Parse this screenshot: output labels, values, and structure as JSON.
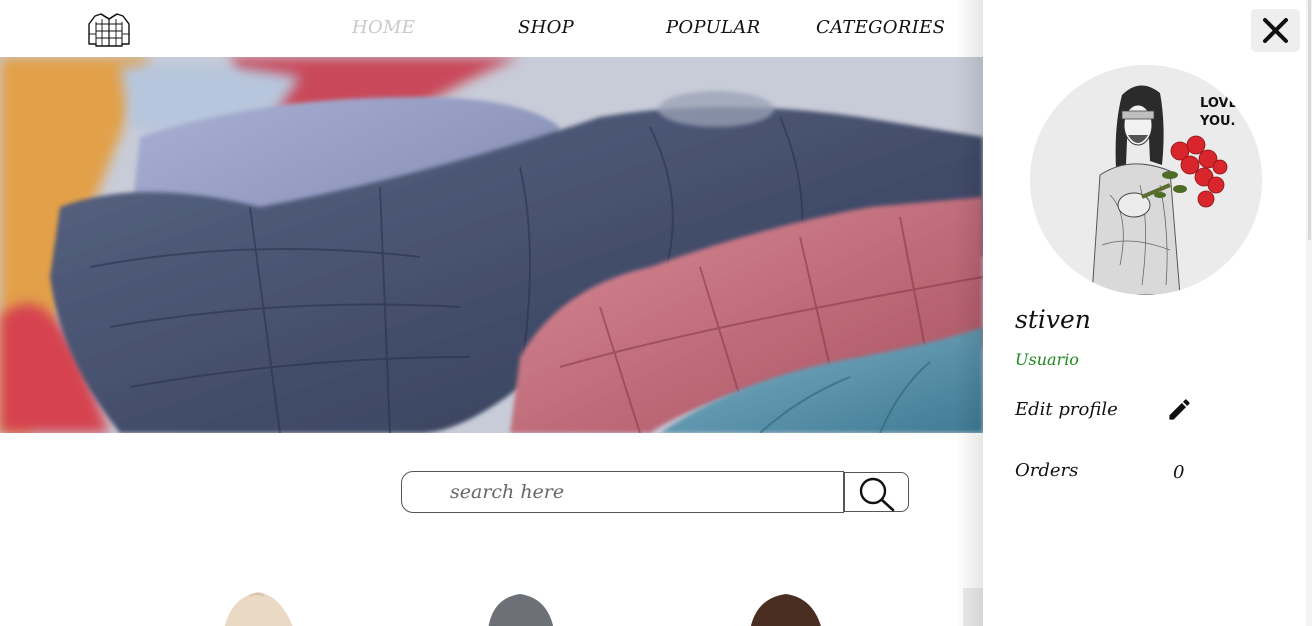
{
  "nav": {
    "logo_icon": "jacket-icon",
    "items": [
      {
        "label": "HOME",
        "active": true
      },
      {
        "label": "SHOP",
        "active": false
      },
      {
        "label": "POPULAR",
        "active": false
      },
      {
        "label": "CATEGORIES",
        "active": false
      }
    ]
  },
  "hero": {
    "image": "puffer-jackets-photo"
  },
  "search": {
    "placeholder": "search here",
    "value": "",
    "button_icon": "search-icon"
  },
  "drawer": {
    "close_icon": "close-icon",
    "avatar": "user-avatar-illustration",
    "username": "stiven",
    "role": "Usuario",
    "edit_profile_label": "Edit profile",
    "edit_icon": "pencil-icon",
    "orders_label": "Orders",
    "orders_count": "0"
  },
  "colors": {
    "nav_active": "#c9c9c9",
    "role_text": "#1e8a1e",
    "close_button_bg": "#eeeeee"
  }
}
